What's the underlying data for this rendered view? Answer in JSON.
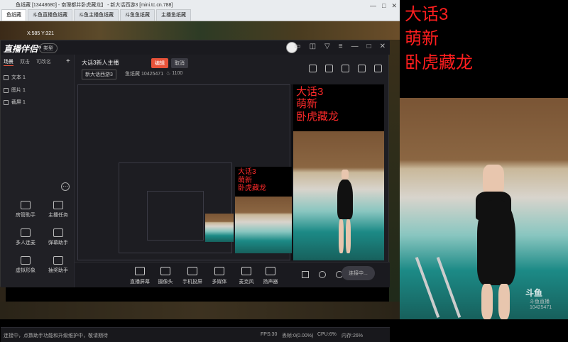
{
  "browser": {
    "title": "鱼纸藏 [13448680] - 南理都并卧虎藏龙】 - 新大话西游3 [mini.tc.cn.788]",
    "tabs": [
      "鱼纸藏",
      "斗鱼直播鱼纸藏",
      "斗鱼主播鱼纸藏",
      "斗鱼鱼纸藏",
      "主播鱼纸藏"
    ],
    "controls": [
      "—",
      "□",
      "✕"
    ]
  },
  "game": {
    "coords": "X:585 Y:321"
  },
  "app": {
    "logo": "直播伴侣°",
    "badge": "类型",
    "header_icons": [
      "minimize-icon",
      "maximize-icon",
      "close-icon"
    ],
    "panel_tabs": [
      "场景",
      "双击",
      "可改名"
    ],
    "sources": [
      {
        "label": "文本 1"
      },
      {
        "label": "图片 1"
      },
      {
        "label": "截屏 1"
      }
    ],
    "tools": [
      {
        "label": "房管助手"
      },
      {
        "label": "主播任务"
      },
      {
        "label": "多人连麦"
      },
      {
        "label": "弹幕助手"
      },
      {
        "label": "虚拟形象"
      },
      {
        "label": "抽奖助手"
      }
    ],
    "room": {
      "title": "大话3新人主播",
      "edit": "编辑",
      "cancel": "取消",
      "category": "新大话西游3",
      "room_id_label": "鱼纸藏",
      "room_id": "10425471",
      "heat": "1100"
    },
    "toolbar": [
      {
        "label": "直播屏幕"
      },
      {
        "label": "摄像头"
      },
      {
        "label": "手机投屏"
      },
      {
        "label": "多媒体"
      },
      {
        "label": "麦克风"
      },
      {
        "label": "扬声器"
      }
    ],
    "start_live": "连接中...",
    "status": {
      "left": "连接中，点数助手功能和升级维护中，敬请期待",
      "fps": "FPS:30",
      "drop": "丢帧:0(0.00%)",
      "cpu": "CPU:6%",
      "mem": "内存:26%"
    }
  },
  "overlay": {
    "lines": [
      "大话3",
      "萌新",
      "卧虎藏龙"
    ]
  },
  "watermark": {
    "logo": "斗鱼",
    "text": "斗鱼直播",
    "id": "10425471"
  },
  "colors": {
    "accent": "#e8533a",
    "overlay_text": "#ff2a2a",
    "pool": "#1c8a86"
  }
}
